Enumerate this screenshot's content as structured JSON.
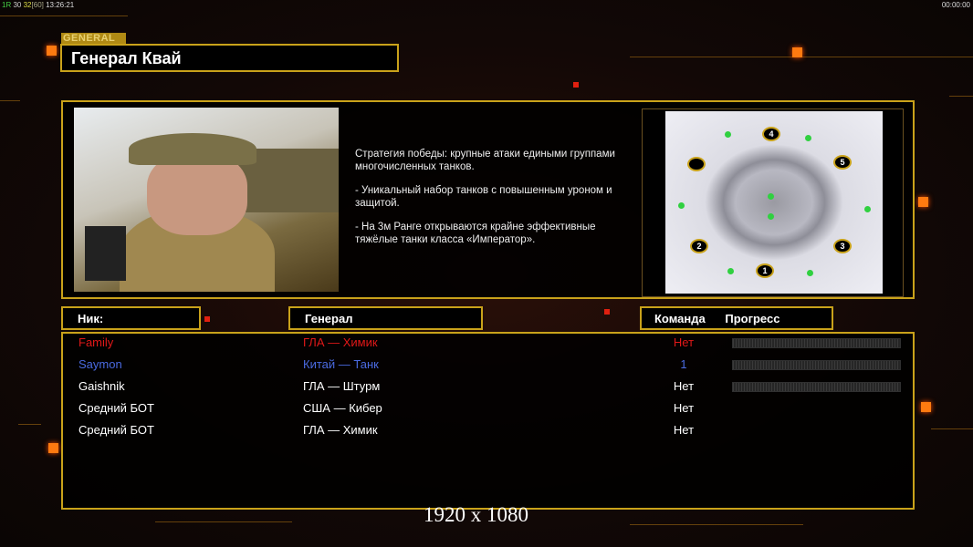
{
  "hud": {
    "fps_prefix": "1R",
    "val1": "30",
    "val2": "32",
    "val3": "[60]",
    "clock": "13:26:21",
    "timer": "00:00:00"
  },
  "header": {
    "tag": "GENERAL",
    "title": "Генерал Квай"
  },
  "description": [
    "Стратегия победы: крупные атаки едиными группами многочисленных танков.",
    "- Уникальный набор танков с повышенным уроном и защитой.",
    "- На 3м Ранге открываются крайне эффективные тяжёлые танки класса «Император»."
  ],
  "map": {
    "spots": [
      "1",
      "2",
      "3",
      "4",
      "5",
      ""
    ]
  },
  "columns": {
    "nick": "Ник:",
    "general": "Генерал",
    "team": "Команда",
    "progress": "Прогресс"
  },
  "players": [
    {
      "nick": "Family",
      "general": "ГЛА — Химик",
      "team": "Нет",
      "color": "#e01818",
      "progress_bar": true
    },
    {
      "nick": "Saymon",
      "general": "Китай — Танк",
      "team": "1",
      "color": "#4a6ae0",
      "progress_bar": true
    },
    {
      "nick": "Gaishnik",
      "general": "ГЛА — Штурм",
      "team": "Нет",
      "color": "#ffffff",
      "progress_bar": true
    },
    {
      "nick": "Средний БОТ",
      "general": "США — Кибер",
      "team": "Нет",
      "color": "#ffffff",
      "progress_bar": false
    },
    {
      "nick": "Средний БОТ",
      "general": "ГЛА — Химик",
      "team": "Нет",
      "color": "#ffffff",
      "progress_bar": false
    }
  ],
  "resolution": "1920 x 1080",
  "colors": {
    "accent": "#c9a21a",
    "orange": "#ff7a10"
  }
}
